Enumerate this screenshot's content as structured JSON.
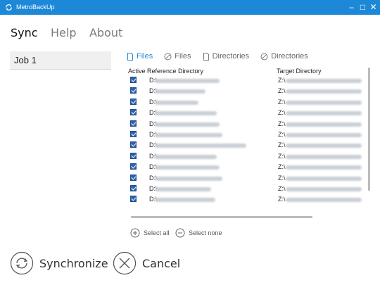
{
  "window": {
    "title": "MetroBackUp",
    "app_icon": "sync-icon",
    "controls": [
      "minimize",
      "maximize",
      "close"
    ],
    "minimize_glyph": "–",
    "maximize_glyph": "□",
    "close_glyph": "✕"
  },
  "nav": {
    "items": [
      "Sync",
      "Help",
      "About"
    ],
    "active": "Sync"
  },
  "job": {
    "value": "Job 1"
  },
  "filters": {
    "tabs": [
      "Files",
      "Files",
      "Directories",
      "Directories"
    ],
    "active": 0
  },
  "table": {
    "headers": {
      "active": "Active",
      "reference": "Reference Directory",
      "target": "Target Directory"
    },
    "rows": [
      {
        "checked": true,
        "ref": "D:\\",
        "tgt": "Z:\\"
      },
      {
        "checked": true,
        "ref": "D:\\",
        "tgt": "Z:\\"
      },
      {
        "checked": true,
        "ref": "D:\\",
        "tgt": "Z:\\"
      },
      {
        "checked": true,
        "ref": "D:\\",
        "tgt": "Z:\\"
      },
      {
        "checked": true,
        "ref": "D:\\",
        "tgt": "Z:\\"
      },
      {
        "checked": true,
        "ref": "D:\\",
        "tgt": "Z:\\"
      },
      {
        "checked": true,
        "ref": "D:\\",
        "tgt": "Z:\\"
      },
      {
        "checked": true,
        "ref": "D:\\",
        "tgt": "Z:\\"
      },
      {
        "checked": true,
        "ref": "D:\\",
        "tgt": "Z:\\"
      },
      {
        "checked": true,
        "ref": "D:\\",
        "tgt": "Z:\\"
      },
      {
        "checked": true,
        "ref": "D:\\",
        "tgt": "Z:\\"
      },
      {
        "checked": true,
        "ref": "D:\\",
        "tgt": "Z:\\"
      }
    ]
  },
  "selection": {
    "select_all": "Select all",
    "select_none": "Select none"
  },
  "actions": {
    "synchronize": "Synchronize",
    "cancel": "Cancel"
  },
  "colors": {
    "accent": "#1e88d8",
    "checkbox": "#2d63ad"
  }
}
